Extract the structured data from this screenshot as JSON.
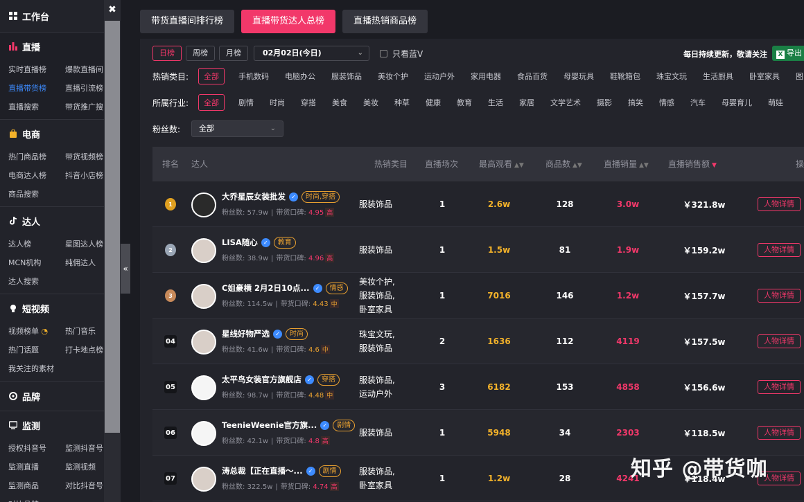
{
  "sidebar": {
    "sections": [
      {
        "title": "工作台",
        "icon": "grid-icon",
        "items": []
      },
      {
        "title": "直播",
        "icon": "bar-chart-icon",
        "items": [
          "实时直播榜",
          "爆款直播间",
          "直播带货榜",
          "直播引流榜",
          "直播搜索",
          "带货推广搜"
        ],
        "active_index": 2
      },
      {
        "title": "电商",
        "icon": "shopping-bag-icon",
        "items": [
          "热门商品榜",
          "带货视频榜",
          "电商达人榜",
          "抖音小店榜",
          "商品搜索"
        ]
      },
      {
        "title": "达人",
        "icon": "tiktok-icon",
        "items": [
          "达人榜",
          "星图达人榜",
          "MCN机构",
          "纯佣达人",
          "达人搜索"
        ]
      },
      {
        "title": "短视频",
        "icon": "bulb-icon",
        "items": [
          "视频榜单",
          "热门音乐",
          "热门话题",
          "打卡地点榜",
          "我关注的素材"
        ]
      },
      {
        "title": "品牌",
        "icon": "badge-icon",
        "items": []
      },
      {
        "title": "监测",
        "icon": "monitor-icon",
        "items": [
          "授权抖音号",
          "监测抖音号",
          "监测直播",
          "监测视频",
          "监测商品",
          "对比抖音号",
          "对比品牌"
        ]
      }
    ]
  },
  "top_tabs": [
    "带货直播间排行榜",
    "直播带货达人总榜",
    "直播热销商品榜"
  ],
  "active_tab": 1,
  "period_buttons": [
    "日榜",
    "周榜",
    "月榜"
  ],
  "date_value": "02月02日(今日)",
  "blue_v_label": "只看蓝V",
  "notice": "每日持续更新，敬请关注",
  "export_label": "导出",
  "hot_category": {
    "label": "热销类目:",
    "options": [
      "全部",
      "手机数码",
      "电脑办公",
      "服装饰品",
      "美妆个护",
      "运动户外",
      "家用电器",
      "食品百货",
      "母婴玩具",
      "鞋靴箱包",
      "珠宝文玩",
      "生活厨具",
      "卧室家具",
      "图"
    ]
  },
  "industry": {
    "label": "所属行业:",
    "options": [
      "全部",
      "剧情",
      "时尚",
      "穿搭",
      "美食",
      "美妆",
      "种草",
      "健康",
      "教育",
      "生活",
      "家居",
      "文学艺术",
      "摄影",
      "搞笑",
      "情感",
      "汽车",
      "母婴育儿",
      "萌娃"
    ]
  },
  "fans": {
    "label": "粉丝数:",
    "value": "全部"
  },
  "table": {
    "headers": {
      "rank": "排名",
      "influencer": "达人",
      "category": "热销类目",
      "sessions": "直播场次",
      "views": "最高观看",
      "goods": "商品数",
      "sales": "直播销量",
      "amount": "直播销售额",
      "action": "操"
    },
    "fans_prefix": "粉丝数:",
    "rep_prefix": "带货口碑:",
    "detail_label": "人物详情",
    "rows": [
      {
        "rank": "1",
        "name": "大乔星辰女装批发",
        "tag": "时尚,穿搭",
        "fans": "57.9w",
        "score": "4.95",
        "level": "高",
        "category": [
          "服装饰品"
        ],
        "sessions": "1",
        "views": "2.6w",
        "goods": "128",
        "sales": "3.0w",
        "amount": "￥321.8w"
      },
      {
        "rank": "2",
        "name": "LISA随心",
        "tag": "教育",
        "fans": "38.9w",
        "score": "4.96",
        "level": "高",
        "category": [
          "服装饰品"
        ],
        "sessions": "1",
        "views": "1.5w",
        "goods": "81",
        "sales": "1.9w",
        "amount": "￥159.2w"
      },
      {
        "rank": "3",
        "name": "C姐豪横 2月2日10点...",
        "tag": "情感",
        "fans": "114.5w",
        "score": "4.43",
        "level": "中",
        "category": [
          "美妆个护,",
          "服装饰品,",
          "卧室家具"
        ],
        "sessions": "1",
        "views": "7016",
        "goods": "146",
        "sales": "1.2w",
        "amount": "￥157.7w"
      },
      {
        "rank": "04",
        "name": "星线好物严选",
        "tag": "时尚",
        "fans": "41.6w",
        "score": "4.6",
        "level": "中",
        "category": [
          "珠宝文玩,",
          "服装饰品"
        ],
        "sessions": "2",
        "views": "1636",
        "goods": "112",
        "sales": "4119",
        "amount": "￥157.5w"
      },
      {
        "rank": "05",
        "name": "太平鸟女装官方旗舰店",
        "tag": "穿搭",
        "fans": "98.7w",
        "score": "4.48",
        "level": "中",
        "category": [
          "服装饰品,",
          "运动户外"
        ],
        "sessions": "3",
        "views": "6182",
        "goods": "153",
        "sales": "4858",
        "amount": "￥156.6w"
      },
      {
        "rank": "06",
        "name": "TeenieWeenie官方旗...",
        "tag": "剧情",
        "fans": "42.1w",
        "score": "4.8",
        "level": "高",
        "category": [
          "服装饰品"
        ],
        "sessions": "1",
        "views": "5948",
        "goods": "34",
        "sales": "2303",
        "amount": "￥118.5w"
      },
      {
        "rank": "07",
        "name": "涛总裁【正在直播～...",
        "tag": "剧情",
        "fans": "322.5w",
        "score": "4.74",
        "level": "高",
        "category": [
          "服装饰品,",
          "卧室家具"
        ],
        "sessions": "1",
        "views": "1.2w",
        "goods": "28",
        "sales": "4241",
        "amount": "￥118.4w"
      }
    ]
  },
  "watermark": "知乎 @带货咖",
  "colors": {
    "accent": "#f2386a",
    "views": "#f3b22a",
    "tag": "#e8a030",
    "link": "#3d8bff",
    "export": "#1a7f45"
  }
}
